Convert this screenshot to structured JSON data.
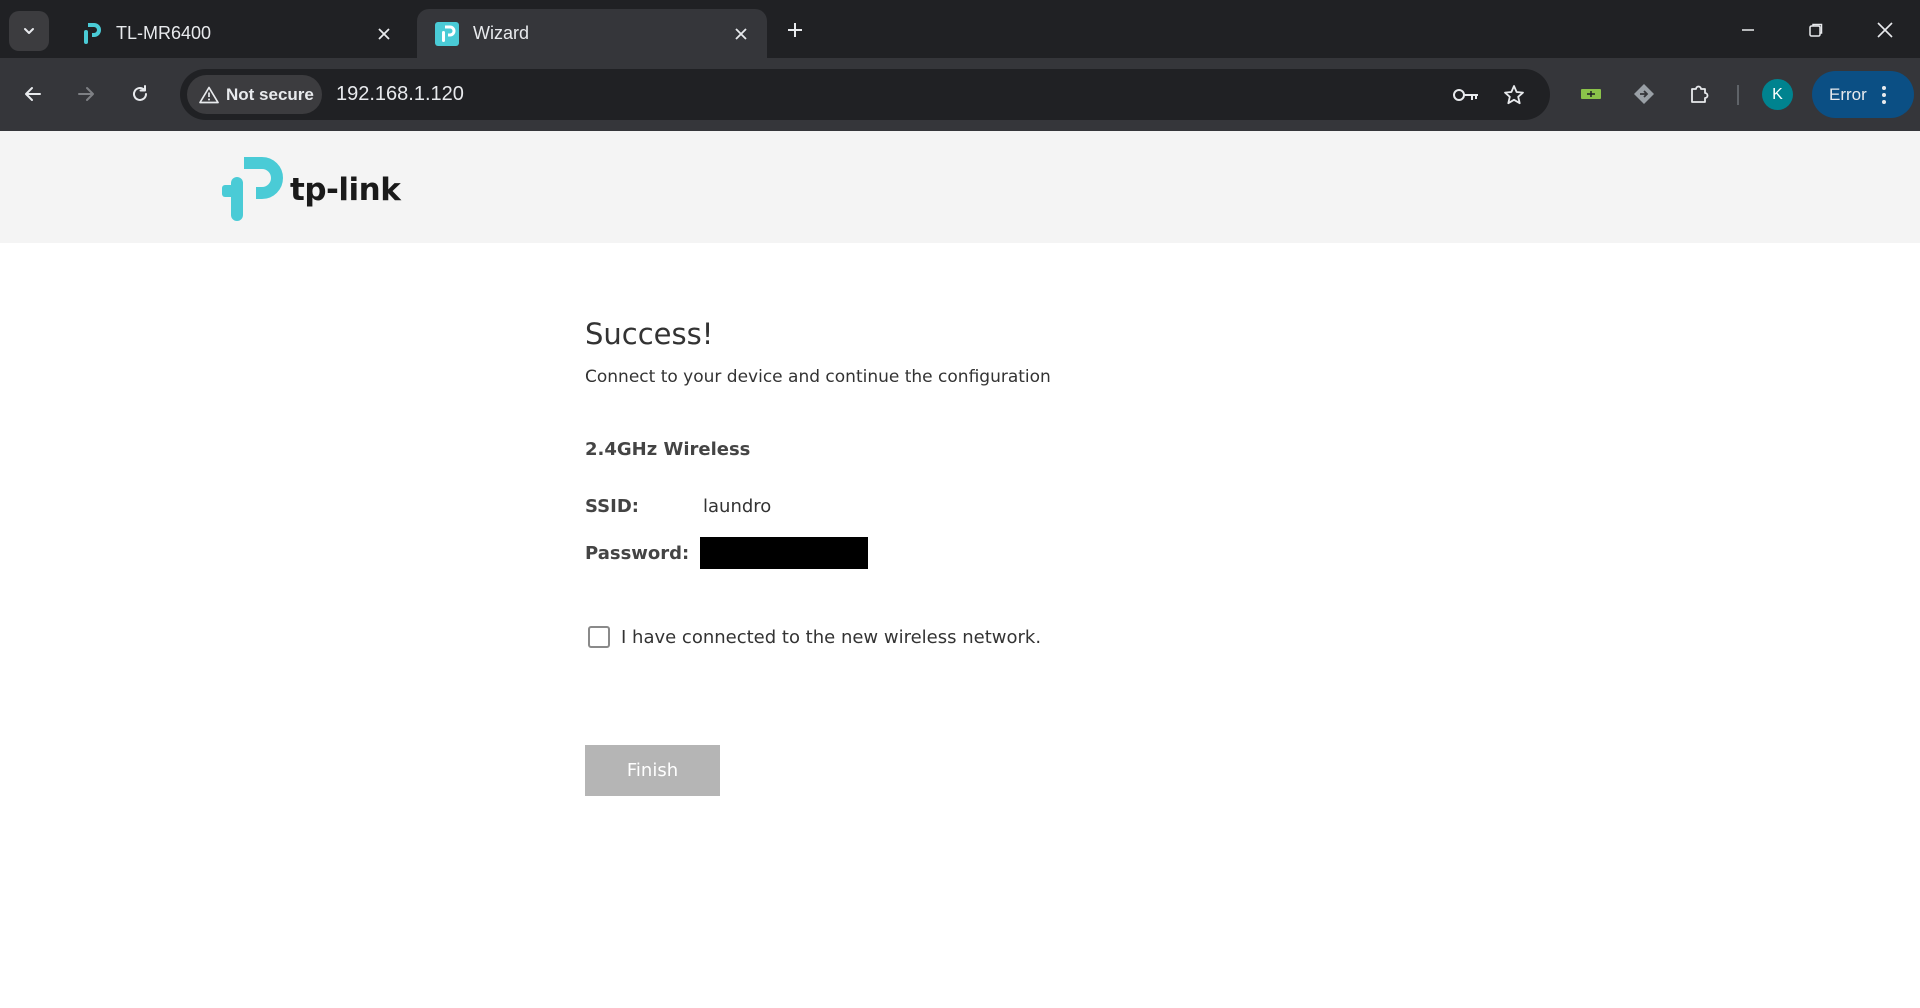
{
  "browser": {
    "tabs": [
      {
        "title": "TL-MR6400",
        "active": false
      },
      {
        "title": "Wizard",
        "active": true
      }
    ],
    "address": {
      "security_label": "Not secure",
      "url": "192.168.1.120"
    },
    "profile_initial": "K",
    "error_label": "Error"
  },
  "header": {
    "logo_text": "tp-link",
    "brand_color": "#4acbd6"
  },
  "main": {
    "heading": "Success!",
    "subtitle": "Connect to your device and continue the configuration",
    "section_title": "2.4GHz Wireless",
    "ssid_label": "SSID:",
    "ssid_value": "laundro",
    "password_label": "Password:",
    "checkbox_label": "I have connected to the new wireless network.",
    "checkbox_checked": false,
    "finish_label": "Finish"
  }
}
